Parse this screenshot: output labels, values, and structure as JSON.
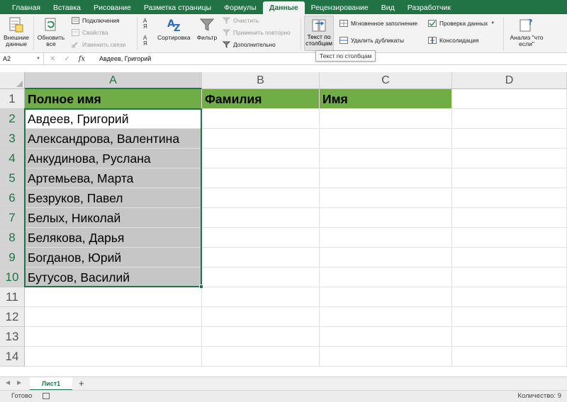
{
  "ribbon": {
    "tabs": [
      "Главная",
      "Вставка",
      "Рисование",
      "Разметка страницы",
      "Формулы",
      "Данные",
      "Рецензирование",
      "Вид",
      "Разработчик"
    ],
    "active_tab": "Данные",
    "external_data": "Внешние\nданные",
    "refresh_all": "Обновить\nвсе",
    "connections": "Подключения",
    "properties": "Свойства",
    "edit_links": "Изменить связи",
    "sort": "Сортировка",
    "filter": "Фильтр",
    "clear": "Очистить",
    "reapply": "Применить повторно",
    "advanced": "Дополнительно",
    "text_to_columns": "Текст по\nстолбцам",
    "flash_fill": "Мгновенное заполнение",
    "remove_duplicates": "Удалить дубликаты",
    "data_validation": "Проверка данных",
    "consolidate": "Консолидация",
    "what_if": "Анализ \"что\nесли\"",
    "tooltip": "Текст по столбцам",
    "sort_az_label": "А\nЯ"
  },
  "formula_bar": {
    "name_box": "A2",
    "cancel_icon": "✕",
    "enter_icon": "✓",
    "fx_label": "fx",
    "value": "Авдеев, Григорий"
  },
  "columns": [
    "A",
    "B",
    "C",
    "D"
  ],
  "rows": [
    "1",
    "2",
    "3",
    "4",
    "5",
    "6",
    "7",
    "8",
    "9",
    "10",
    "11",
    "12",
    "13",
    "14"
  ],
  "header_row": {
    "a": "Полное имя",
    "b": "Фамилия",
    "c": "Имя"
  },
  "names": [
    "Авдеев, Григорий",
    "Александрова, Валентина",
    "Анкудинова, Руслана",
    "Артемьева, Марта",
    "Безруков, Павел",
    "Белых, Николай",
    "Белякова, Дарья",
    "Богданов, Юрий",
    "Бутусов, Василий"
  ],
  "sheets": [
    "Лист1"
  ],
  "add_sheet": "+",
  "status": {
    "ready": "Готово",
    "count": "Количество: 9"
  },
  "colors": {
    "accent": "#217346",
    "header_fill": "#70ad47",
    "selection_fill": "#c6c6c6"
  }
}
